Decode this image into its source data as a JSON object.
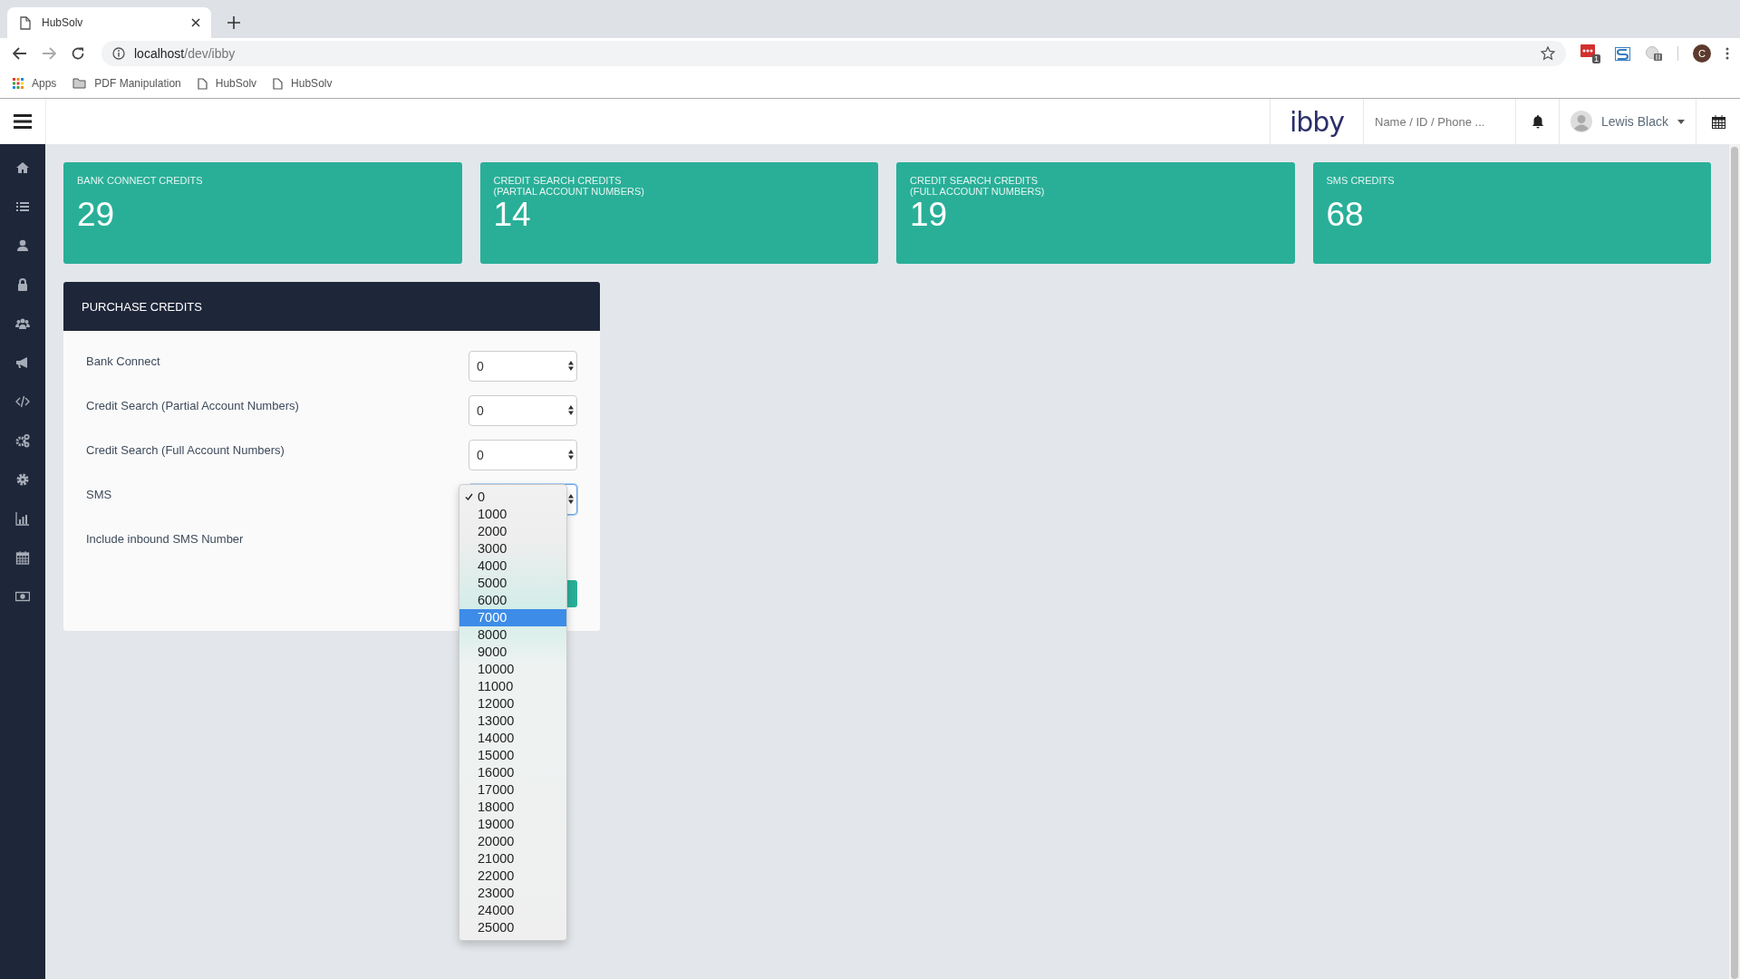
{
  "browser": {
    "tab": {
      "title": "HubSolv"
    },
    "address": {
      "host": "localhost",
      "path": "/dev/ibby"
    },
    "extension_badge": "1",
    "profile_initial": "C",
    "bookmarks": [
      {
        "kind": "apps",
        "label": "Apps"
      },
      {
        "kind": "folder",
        "label": "PDF Manipulation"
      },
      {
        "kind": "page",
        "label": "HubSolv"
      },
      {
        "kind": "page",
        "label": "HubSolv"
      }
    ]
  },
  "header": {
    "logo": "ibby",
    "search": {
      "placeholder": "Name / ID / Phone ..."
    },
    "user": "Lewis Black"
  },
  "cards": [
    {
      "title": "BANK CONNECT CREDITS",
      "value": "29"
    },
    {
      "title": "CREDIT SEARCH CREDITS\n(PARTIAL ACCOUNT NUMBERS)",
      "value": "14"
    },
    {
      "title": "CREDIT SEARCH CREDITS\n(FULL ACCOUNT NUMBERS)",
      "value": "19"
    },
    {
      "title": "SMS CREDITS",
      "value": "68"
    }
  ],
  "panel": {
    "title": "PURCHASE CREDITS",
    "rows": [
      {
        "kind": "select",
        "label": "Bank Connect",
        "value": "0",
        "focused": false
      },
      {
        "kind": "select",
        "label": "Credit Search (Partial Account Numbers)",
        "value": "0",
        "focused": false
      },
      {
        "kind": "select",
        "label": "Credit Search (Full Account Numbers)",
        "value": "0",
        "focused": false
      },
      {
        "kind": "select",
        "label": "SMS",
        "focused": true,
        "open": true
      },
      {
        "kind": "text",
        "label": "Include inbound SMS Number"
      }
    ]
  },
  "dropdown": {
    "options": [
      {
        "label": "0",
        "checked": true,
        "highlighted": false
      },
      {
        "label": "1000",
        "checked": false,
        "highlighted": false
      },
      {
        "label": "2000",
        "checked": false,
        "highlighted": false
      },
      {
        "label": "3000",
        "checked": false,
        "highlighted": false
      },
      {
        "label": "4000",
        "checked": false,
        "highlighted": false
      },
      {
        "label": "5000",
        "checked": false,
        "highlighted": false
      },
      {
        "label": "6000",
        "checked": false,
        "highlighted": false
      },
      {
        "label": "7000",
        "checked": false,
        "highlighted": true
      },
      {
        "label": "8000",
        "checked": false,
        "highlighted": false
      },
      {
        "label": "9000",
        "checked": false,
        "highlighted": false
      },
      {
        "label": "10000",
        "checked": false,
        "highlighted": false
      },
      {
        "label": "11000",
        "checked": false,
        "highlighted": false
      },
      {
        "label": "12000",
        "checked": false,
        "highlighted": false
      },
      {
        "label": "13000",
        "checked": false,
        "highlighted": false
      },
      {
        "label": "14000",
        "checked": false,
        "highlighted": false
      },
      {
        "label": "15000",
        "checked": false,
        "highlighted": false
      },
      {
        "label": "16000",
        "checked": false,
        "highlighted": false
      },
      {
        "label": "17000",
        "checked": false,
        "highlighted": false
      },
      {
        "label": "18000",
        "checked": false,
        "highlighted": false
      },
      {
        "label": "19000",
        "checked": false,
        "highlighted": false
      },
      {
        "label": "20000",
        "checked": false,
        "highlighted": false
      },
      {
        "label": "21000",
        "checked": false,
        "highlighted": false
      },
      {
        "label": "22000",
        "checked": false,
        "highlighted": false
      },
      {
        "label": "23000",
        "checked": false,
        "highlighted": false
      },
      {
        "label": "24000",
        "checked": false,
        "highlighted": false
      },
      {
        "label": "25000",
        "checked": false,
        "highlighted": false
      }
    ]
  }
}
